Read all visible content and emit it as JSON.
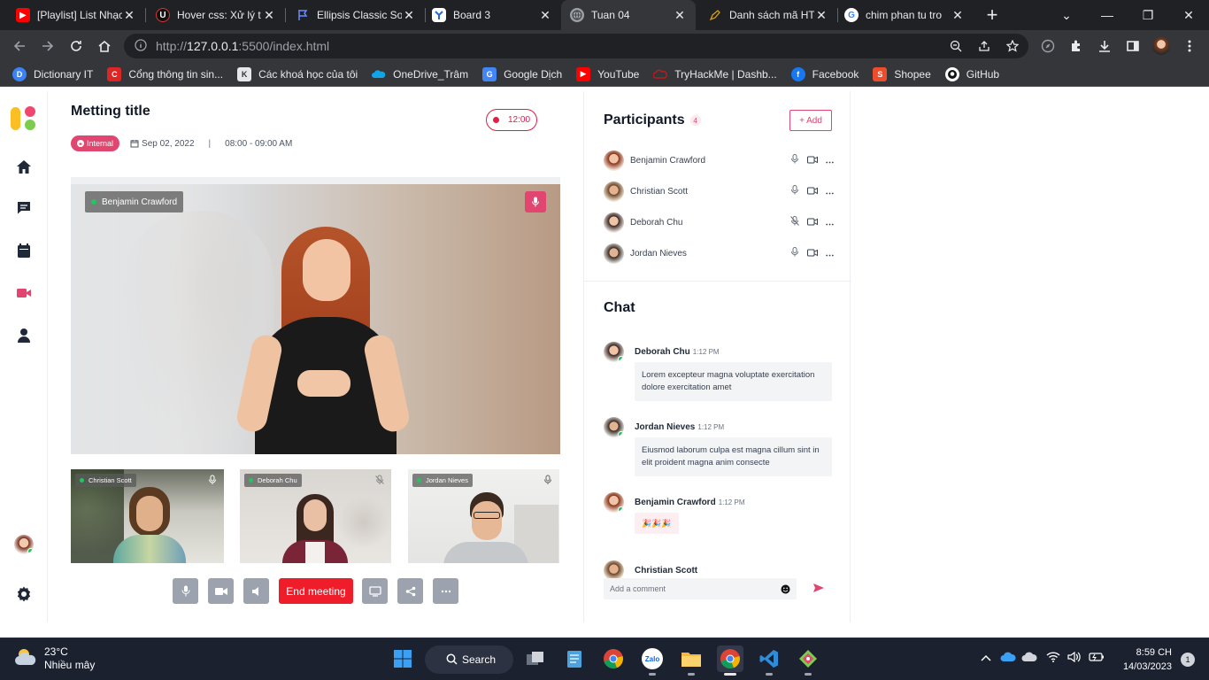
{
  "browser": {
    "tabs": [
      {
        "title": "[Playlist] List Nhạc",
        "icon": "youtube-icon",
        "color": "#ff0000"
      },
      {
        "title": "Hover css: Xử lý t",
        "icon": "u-icon",
        "color": "#111111"
      },
      {
        "title": "Ellipsis Classic So",
        "icon": "flag-icon",
        "color": "#4a6cf7"
      },
      {
        "title": "Board 3",
        "icon": "board-icon",
        "color": "#4a90e2"
      },
      {
        "title": "Tuan 04",
        "icon": "globe-icon",
        "color": "#9aa0a6",
        "active": true
      },
      {
        "title": "Danh sách mã HT",
        "icon": "pencil-icon",
        "color": "#d4a017"
      },
      {
        "title": "chim phan tu tro",
        "icon": "google-icon",
        "color": "#4285f4"
      }
    ],
    "url_prefix": "http://",
    "url_host": "127.0.0.1",
    "url_rest": ":5500/index.html",
    "bookmarks": [
      {
        "label": "Dictionary IT",
        "color": "#3b82f6"
      },
      {
        "label": "Cổng thông tin sin...",
        "color": "#dc2626"
      },
      {
        "label": "Các khoá học của tôi",
        "color": "#e5e7eb"
      },
      {
        "label": "OneDrive_Trâm",
        "color": "#0ea5e9"
      },
      {
        "label": "Google Dịch",
        "color": "#4285f4"
      },
      {
        "label": "YouTube",
        "color": "#ff0000"
      },
      {
        "label": "TryHackMe | Dashb...",
        "color": "#b91c1c"
      },
      {
        "label": "Facebook",
        "color": "#1877f2"
      },
      {
        "label": "Shopee",
        "color": "#ee4d2d"
      },
      {
        "label": "GitHub",
        "color": "#ffffff"
      }
    ]
  },
  "meeting": {
    "title": "Metting title",
    "badge": "Internal",
    "date": "Sep 02, 2022",
    "separator": "|",
    "time_range": "08:00 - 09:00 AM",
    "timer": "12:00",
    "main_speaker": "Benjamin Crawford",
    "thumbnails": [
      {
        "name": "Christian Scott",
        "muted": false
      },
      {
        "name": "Deborah Chu",
        "muted": true
      },
      {
        "name": "Jordan Nieves",
        "muted": false
      }
    ],
    "end_label": "End meeting"
  },
  "participants": {
    "title": "Participants",
    "count": "4",
    "add_label": "+ Add",
    "list": [
      {
        "name": "Benjamin Crawford",
        "muted": false
      },
      {
        "name": "Christian Scott",
        "muted": false
      },
      {
        "name": "Deborah Chu",
        "muted": true
      },
      {
        "name": "Jordan Nieves",
        "muted": false
      }
    ]
  },
  "chat": {
    "title": "Chat",
    "messages": [
      {
        "name": "Deborah Chu",
        "time": "1:12 PM",
        "text": "Lorem excepteur magna voluptate exercitation dolore exercitation amet"
      },
      {
        "name": "Jordan Nieves",
        "time": "1:12 PM",
        "text": "Eiusmod laborum culpa est magna cillum sint in elit proident magna anim consecte"
      },
      {
        "name": "Benjamin Crawford",
        "time": "1:12 PM",
        "text": "🎉🎉🎉"
      },
      {
        "name": "Christian Scott",
        "time": "",
        "text": ""
      }
    ],
    "placeholder": "Add a comment"
  },
  "taskbar": {
    "temperature": "23°C",
    "weather": "Nhiều mây",
    "search_label": "Search",
    "time": "8:59 CH",
    "date": "14/03/2023",
    "notifications": "1"
  },
  "colors": {
    "accent": "#e0466f",
    "end_meeting": "#ef1c2a",
    "online": "#22c55e"
  }
}
